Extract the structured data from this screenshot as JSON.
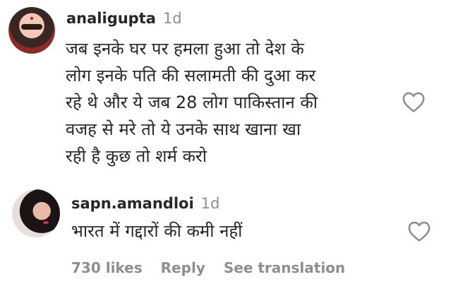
{
  "comments": [
    {
      "username": "analigupta",
      "timestamp": "1d",
      "text": "जब इनके घर पर हमला हुआ तो देश के\nलोग इनके पति की सलामती की दुआ कर\nरहे थे और ये जब 28 लोग पाकिस्तान की\nवजह से मरे तो ये उनके साथ खाना खा\nरही है कुछ तो शर्म करो",
      "like_icon": "heart-outline-icon"
    },
    {
      "username": "sapn.amandloi",
      "timestamp": "1d",
      "text": "भारत में गद्दारों की कमी नहीं",
      "like_icon": "heart-outline-icon",
      "likes": "730 likes",
      "reply_label": "Reply",
      "translation_label": "See translation"
    }
  ],
  "colors": {
    "text": "#262626",
    "muted": "#8e8e8e",
    "background": "#ffffff"
  }
}
